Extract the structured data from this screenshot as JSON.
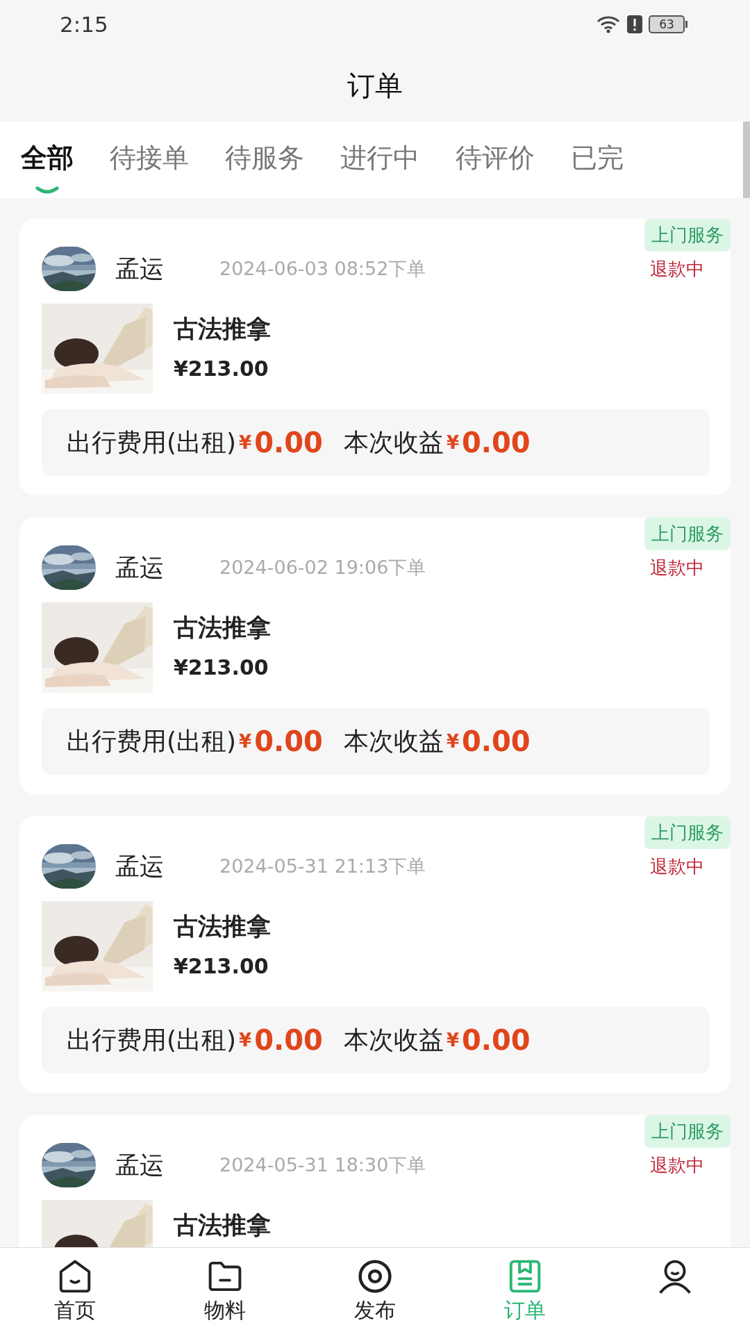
{
  "status_bar": {
    "time": "2:15",
    "battery": "63"
  },
  "header": {
    "title": "订单"
  },
  "tabs": [
    {
      "label": "全部",
      "selected": true
    },
    {
      "label": "待接单",
      "selected": false
    },
    {
      "label": "待服务",
      "selected": false
    },
    {
      "label": "进行中",
      "selected": false
    },
    {
      "label": "待评价",
      "selected": false
    },
    {
      "label": "已完",
      "selected": false
    }
  ],
  "orders": [
    {
      "tag": "上门服务",
      "name": "孟运",
      "time": "2024-06-03 08:52下单",
      "status": "退款中",
      "title": "古法推拿",
      "price": "¥213.00",
      "travel_fee": {
        "label": "出行费用(出租)",
        "symbol": "¥",
        "amount": "0.00"
      },
      "earnings": {
        "label": "本次收益",
        "symbol": "¥",
        "amount": "0.00"
      }
    },
    {
      "tag": "上门服务",
      "name": "孟运",
      "time": "2024-06-02 19:06下单",
      "status": "退款中",
      "title": "古法推拿",
      "price": "¥213.00",
      "travel_fee": {
        "label": "出行费用(出租)",
        "symbol": "¥",
        "amount": "0.00"
      },
      "earnings": {
        "label": "本次收益",
        "symbol": "¥",
        "amount": "0.00"
      }
    },
    {
      "tag": "上门服务",
      "name": "孟运",
      "time": "2024-05-31 21:13下单",
      "status": "退款中",
      "title": "古法推拿",
      "price": "¥213.00",
      "travel_fee": {
        "label": "出行费用(出租)",
        "symbol": "¥",
        "amount": "0.00"
      },
      "earnings": {
        "label": "本次收益",
        "symbol": "¥",
        "amount": "0.00"
      }
    },
    {
      "tag": "上门服务",
      "name": "孟运",
      "time": "2024-05-31 18:30下单",
      "status": "退款中",
      "title": "古法推拿"
    }
  ],
  "bottom_nav": [
    {
      "kind": "home",
      "label": "首页",
      "selected": false
    },
    {
      "kind": "folder",
      "label": "物料",
      "selected": false
    },
    {
      "kind": "publish",
      "label": "发布",
      "selected": false
    },
    {
      "kind": "orders",
      "label": "订单",
      "selected": true
    },
    {
      "kind": "profile",
      "selected": false
    }
  ]
}
